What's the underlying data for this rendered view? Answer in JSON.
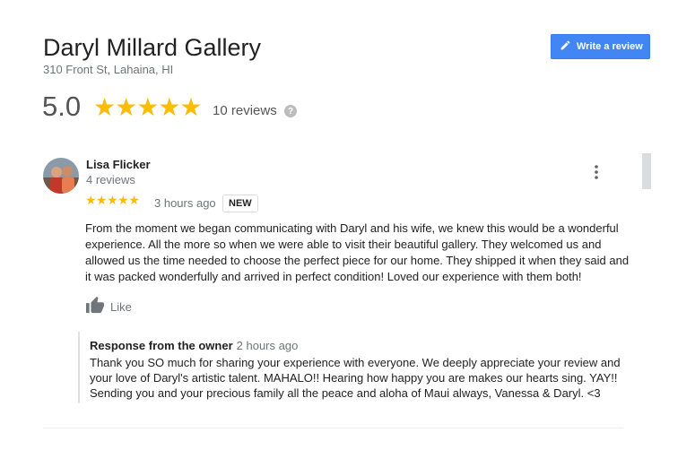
{
  "business": {
    "name": "Daryl Millard Gallery",
    "address": "310 Front St, Lahaina, HI"
  },
  "toolbar": {
    "write_review_label": "Write a review"
  },
  "summary": {
    "rating": "5.0",
    "stars": "★★★★★",
    "review_count": "10 reviews",
    "help_glyph": "?"
  },
  "review": {
    "reviewer_name": "Lisa Flicker",
    "reviewer_count": "4 reviews",
    "stars": "★★★★★",
    "rating_value": 5,
    "time_ago": "3 hours ago",
    "badge": "NEW",
    "text": "From the moment we began communicating with Daryl and his wife, we knew this would be a wonderful experience. All the more so when we were able to visit their beautiful gallery. They welcomed us and allowed us the time needed to choose the perfect piece for our home. They shipped it when they said and it was packed wonderfully and arrived in perfect condition! Loved our experience with them both!",
    "like_label": "Like"
  },
  "owner_response": {
    "heading": "Response from the owner",
    "time_ago": "2 hours ago",
    "text": "Thank you SO much for sharing your experience with everyone. We deeply appreciate your review and your love of Daryl's artistic talent. MAHALO!! Hearing how happy you are makes our hearts sing. YAY!! Sending you and your precious family all the peace and aloha of Maui always, Vanessa & Daryl. <3"
  },
  "colors": {
    "accent": "#4285f4",
    "star": "#fbbc04",
    "muted": "#70757a"
  }
}
